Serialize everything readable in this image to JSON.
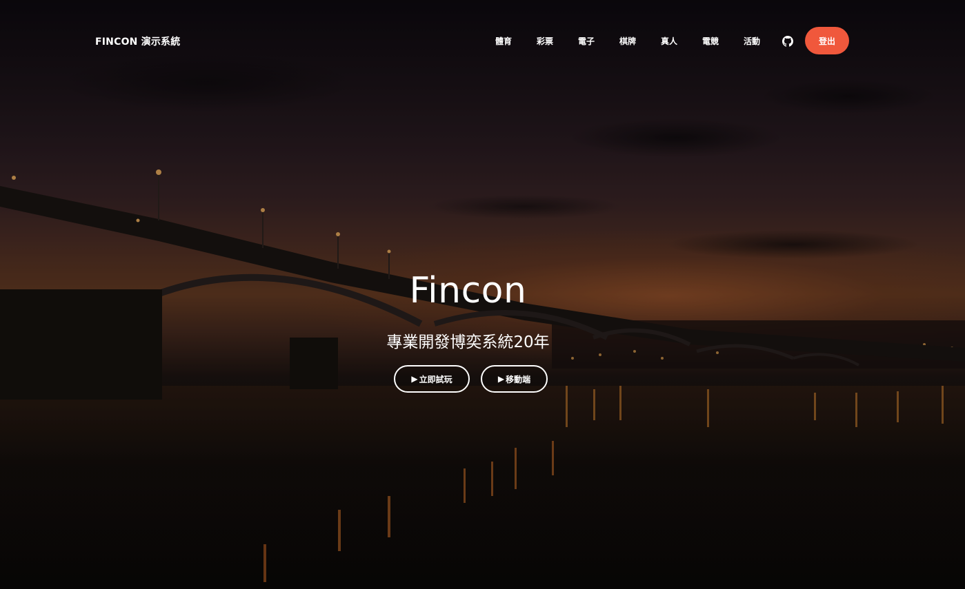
{
  "brand": "FINCON 演示系統",
  "nav": {
    "items": [
      {
        "label": "體育"
      },
      {
        "label": "彩票"
      },
      {
        "label": "電子"
      },
      {
        "label": "棋牌"
      },
      {
        "label": "真人"
      },
      {
        "label": "電競"
      },
      {
        "label": "活動"
      }
    ],
    "github_icon": "github-icon",
    "logout_label": "登出"
  },
  "hero": {
    "title": "Fincon",
    "subtitle": "專業開發博奕系統20年",
    "buttons": {
      "play_label": "立即試玩",
      "mobile_label": "移動端",
      "play_icon": "▶",
      "mobile_icon": "▶"
    }
  },
  "colors": {
    "accent": "#f0583c",
    "text": "#ffffff"
  }
}
